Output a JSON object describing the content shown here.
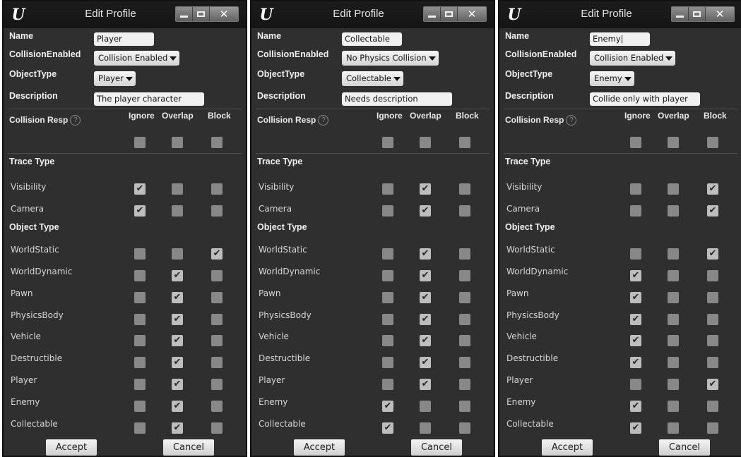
{
  "panels": [
    {
      "title": "Edit Profile",
      "logo": "U",
      "close_glyph": "✕",
      "labels": {
        "name": "Name",
        "collision_enabled": "CollisionEnabled",
        "object_type": "ObjectType",
        "description": "Description"
      },
      "name_value": "Player",
      "collision_enabled_value": "Collision Enabled",
      "object_type_value": "Player",
      "description_value": "The player character",
      "collision_response_label": "Collision Resp",
      "help_glyph": "?",
      "columns": [
        "Ignore",
        "Overlap",
        "Block"
      ],
      "trace_type_label": "Trace Type",
      "object_type_section_label": "Object Type",
      "all_row": [
        false,
        false,
        false
      ],
      "trace_rows": [
        {
          "label": "Visibility",
          "checks": [
            true,
            false,
            false
          ]
        },
        {
          "label": "Camera",
          "checks": [
            true,
            false,
            false
          ]
        }
      ],
      "object_rows": [
        {
          "label": "WorldStatic",
          "checks": [
            false,
            false,
            true
          ]
        },
        {
          "label": "WorldDynamic",
          "checks": [
            false,
            true,
            false
          ]
        },
        {
          "label": "Pawn",
          "checks": [
            false,
            true,
            false
          ]
        },
        {
          "label": "PhysicsBody",
          "checks": [
            false,
            true,
            false
          ]
        },
        {
          "label": "Vehicle",
          "checks": [
            false,
            true,
            false
          ]
        },
        {
          "label": "Destructible",
          "checks": [
            false,
            true,
            false
          ]
        },
        {
          "label": "Player",
          "checks": [
            false,
            true,
            false
          ]
        },
        {
          "label": "Enemy",
          "checks": [
            false,
            true,
            false
          ]
        },
        {
          "label": "Collectable",
          "checks": [
            false,
            true,
            false
          ]
        }
      ],
      "accept_label": "Accept",
      "cancel_label": "Cancel"
    },
    {
      "title": "Edit Profile",
      "logo": "U",
      "close_glyph": "✕",
      "labels": {
        "name": "Name",
        "collision_enabled": "CollisionEnabled",
        "object_type": "ObjectType",
        "description": "Description"
      },
      "name_value": "Collectable",
      "collision_enabled_value": "No Physics Collision",
      "object_type_value": "Collectable",
      "description_value": "Needs description",
      "collision_response_label": "Collision Resp",
      "help_glyph": "?",
      "columns": [
        "Ignore",
        "Overlap",
        "Block"
      ],
      "trace_type_label": "Trace Type",
      "object_type_section_label": "Object Type",
      "all_row": [
        false,
        false,
        false
      ],
      "trace_rows": [
        {
          "label": "Visibility",
          "checks": [
            false,
            true,
            false
          ]
        },
        {
          "label": "Camera",
          "checks": [
            false,
            true,
            false
          ]
        }
      ],
      "object_rows": [
        {
          "label": "WorldStatic",
          "checks": [
            false,
            true,
            false
          ]
        },
        {
          "label": "WorldDynamic",
          "checks": [
            false,
            true,
            false
          ]
        },
        {
          "label": "Pawn",
          "checks": [
            false,
            true,
            false
          ]
        },
        {
          "label": "PhysicsBody",
          "checks": [
            false,
            true,
            false
          ]
        },
        {
          "label": "Vehicle",
          "checks": [
            false,
            true,
            false
          ]
        },
        {
          "label": "Destructible",
          "checks": [
            false,
            true,
            false
          ]
        },
        {
          "label": "Player",
          "checks": [
            false,
            true,
            false
          ]
        },
        {
          "label": "Enemy",
          "checks": [
            true,
            false,
            false
          ]
        },
        {
          "label": "Collectable",
          "checks": [
            true,
            false,
            false
          ]
        }
      ],
      "accept_label": "Accept",
      "cancel_label": "Cancel"
    },
    {
      "title": "Edit Profile",
      "logo": "U",
      "close_glyph": "✕",
      "labels": {
        "name": "Name",
        "collision_enabled": "CollisionEnabled",
        "object_type": "ObjectType",
        "description": "Description"
      },
      "name_value": "Enemy|",
      "collision_enabled_value": "Collision Enabled",
      "object_type_value": "Enemy",
      "description_value": "Collide only with player",
      "collision_response_label": "Collision Resp",
      "help_glyph": "?",
      "columns": [
        "Ignore",
        "Overlap",
        "Block"
      ],
      "trace_type_label": "Trace Type",
      "object_type_section_label": "Object Type",
      "all_row": [
        false,
        false,
        false
      ],
      "trace_rows": [
        {
          "label": "Visibility",
          "checks": [
            false,
            false,
            true
          ]
        },
        {
          "label": "Camera",
          "checks": [
            false,
            false,
            true
          ]
        }
      ],
      "object_rows": [
        {
          "label": "WorldStatic",
          "checks": [
            false,
            false,
            true
          ]
        },
        {
          "label": "WorldDynamic",
          "checks": [
            true,
            false,
            false
          ]
        },
        {
          "label": "Pawn",
          "checks": [
            true,
            false,
            false
          ]
        },
        {
          "label": "PhysicsBody",
          "checks": [
            true,
            false,
            false
          ]
        },
        {
          "label": "Vehicle",
          "checks": [
            true,
            false,
            false
          ]
        },
        {
          "label": "Destructible",
          "checks": [
            true,
            false,
            false
          ]
        },
        {
          "label": "Player",
          "checks": [
            false,
            false,
            true
          ]
        },
        {
          "label": "Enemy",
          "checks": [
            true,
            false,
            false
          ]
        },
        {
          "label": "Collectable",
          "checks": [
            true,
            false,
            false
          ]
        }
      ],
      "accept_label": "Accept",
      "cancel_label": "Cancel"
    }
  ],
  "check_glyph": "✔"
}
